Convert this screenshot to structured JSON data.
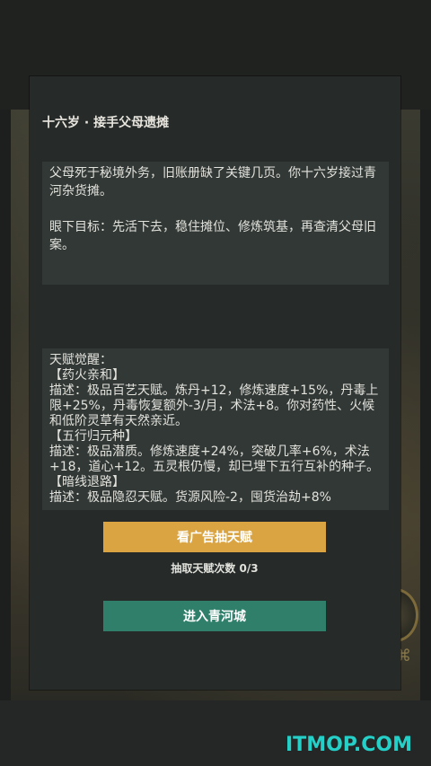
{
  "dialog": {
    "title": "十六岁 · 接手父母遗摊",
    "story": {
      "paragraph1": "父母死于秘境外务，旧账册缺了关键几页。你十六岁接过青河杂货摊。",
      "paragraph2": "眼下目标：先活下去，稳住摊位、修炼筑基，再查清父母旧案。"
    },
    "talents": {
      "heading": "天赋觉醒：",
      "lines": [
        "【药火亲和】",
        "描述：极品百艺天赋。炼丹+12，修炼速度+15%，丹毒上限+25%，丹毒恢复额外-3/月，术法+8。你对药性、火候和低阶灵草有天然亲近。",
        "【五行归元种】",
        "描述：极品潜质。修炼速度+24%，突破几率+6%，术法+18，道心+12。五灵根仍慢，却已埋下五行互补的种子。",
        "【暗线退路】",
        "描述：极品隐忍天赋。货源风险-2，囤货治劫+8%"
      ]
    },
    "ad_button_label": "看广告抽天赋",
    "draw_count_text": "抽取天赋次数 0/3",
    "enter_button_label": "进入青河城"
  },
  "watermark": "ITMOP.COM",
  "colors": {
    "panel": "#262b2a",
    "text_box": "#323836",
    "ad_button": "#d9a441",
    "enter_button": "#2f7f6a",
    "watermark": "#25d0c8"
  }
}
